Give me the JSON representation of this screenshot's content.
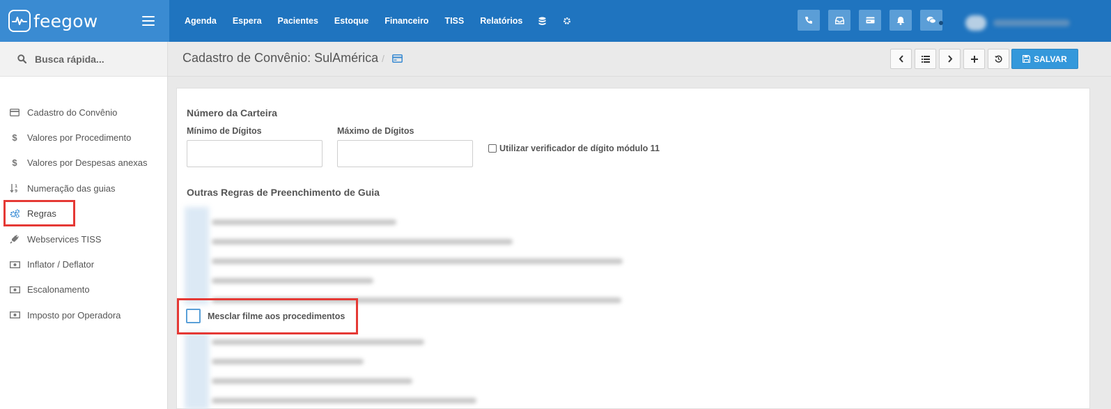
{
  "brand": {
    "logo_text": "feegow"
  },
  "nav": {
    "items": [
      {
        "label": "Agenda"
      },
      {
        "label": "Espera"
      },
      {
        "label": "Pacientes"
      },
      {
        "label": "Estoque"
      },
      {
        "label": "Financeiro"
      },
      {
        "label": "TISS"
      },
      {
        "label": "Relatórios"
      }
    ],
    "icons": [
      "database-icon",
      "gear-icon"
    ]
  },
  "top_actions": [
    "phone-icon",
    "inbox-icon",
    "card-icon",
    "bell-icon",
    "chat-icon"
  ],
  "search": {
    "placeholder": "Busca rápida..."
  },
  "sidebar": {
    "items": [
      {
        "label": "Cadastro do Convênio",
        "icon": "credit-card-icon"
      },
      {
        "label": "Valores por Procedimento",
        "icon": "dollar-icon"
      },
      {
        "label": "Valores por Despesas anexas",
        "icon": "dollar-icon"
      },
      {
        "label": "Numeração das guias",
        "icon": "sort-numeric-icon"
      },
      {
        "label": "Regras",
        "icon": "gears-icon",
        "highlighted": true
      },
      {
        "label": "Webservices TISS",
        "icon": "plug-icon"
      },
      {
        "label": "Inflator / Deflator",
        "icon": "money-icon"
      },
      {
        "label": "Escalonamento",
        "icon": "money-icon"
      },
      {
        "label": "Imposto por Operadora",
        "icon": "money-icon"
      }
    ]
  },
  "header": {
    "title": "Cadastro de Convênio: SulAmérica",
    "separator": "/",
    "save_label": "SALVAR"
  },
  "form": {
    "card_title": "Número da Carteira",
    "min_label": "Mínimo de Dígitos",
    "max_label": "Máximo de Dígitos",
    "min_value": "",
    "max_value": "",
    "mod11_label": "Utilizar verificador de dígito módulo 11",
    "mod11_checked": false,
    "rules_title": "Outras Regras de Preenchimento de Guia",
    "mesclar_label": "Mesclar filme aos procedimentos",
    "mesclar_checked": false
  },
  "colors": {
    "topbar": "#1f74bf",
    "brand": "#3a8bd2",
    "accent": "#3498db",
    "highlight": "#e53935"
  }
}
